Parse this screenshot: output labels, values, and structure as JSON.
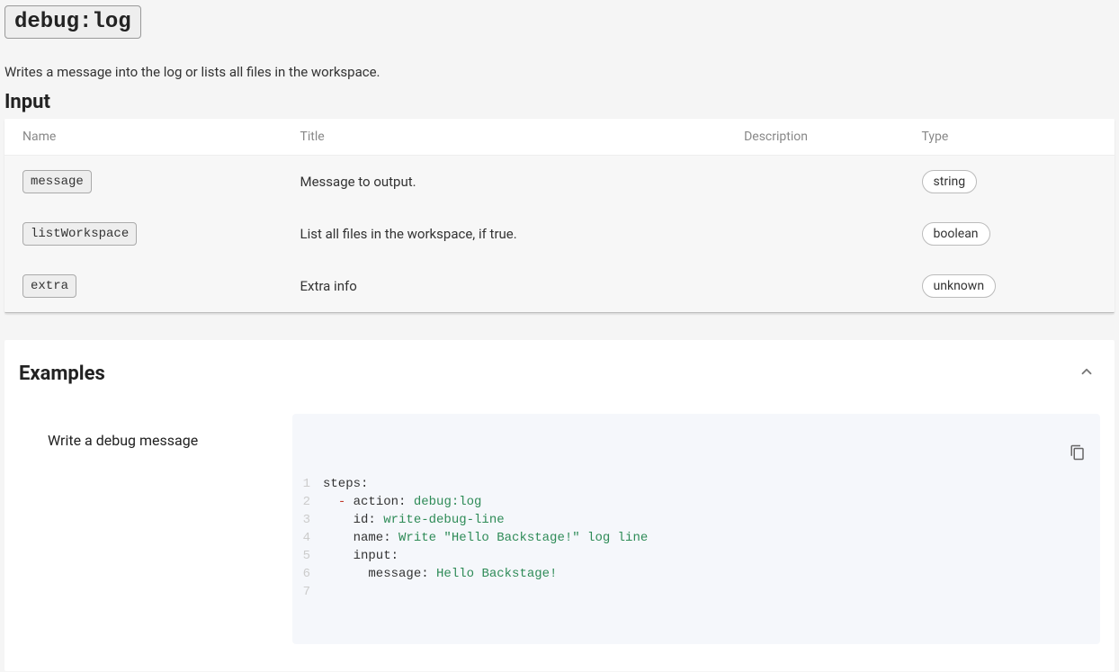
{
  "action": {
    "name": "debug:log",
    "description": "Writes a message into the log or lists all files in the workspace."
  },
  "input": {
    "heading": "Input",
    "columns": {
      "name": "Name",
      "title": "Title",
      "description": "Description",
      "type": "Type"
    },
    "rows": [
      {
        "name": "message",
        "title": "Message to output.",
        "description": "",
        "type": "string"
      },
      {
        "name": "listWorkspace",
        "title": "List all files in the workspace, if true.",
        "description": "",
        "type": "boolean"
      },
      {
        "name": "extra",
        "title": "Extra info",
        "description": "",
        "type": "unknown"
      }
    ]
  },
  "examples": {
    "heading": "Examples",
    "items": [
      {
        "label": "Write a debug message",
        "code_lines": [
          [
            {
              "t": "plain",
              "v": "steps:"
            }
          ],
          [
            {
              "t": "plain",
              "v": "  "
            },
            {
              "t": "dash",
              "v": "-"
            },
            {
              "t": "plain",
              "v": " action: "
            },
            {
              "t": "str",
              "v": "debug:log"
            }
          ],
          [
            {
              "t": "plain",
              "v": "    id: "
            },
            {
              "t": "str",
              "v": "write-debug-line"
            }
          ],
          [
            {
              "t": "plain",
              "v": "    name: "
            },
            {
              "t": "str",
              "v": "Write \"Hello Backstage!\" log line"
            }
          ],
          [
            {
              "t": "plain",
              "v": "    input:"
            }
          ],
          [
            {
              "t": "plain",
              "v": "      message: "
            },
            {
              "t": "str",
              "v": "Hello Backstage!"
            }
          ],
          []
        ]
      }
    ]
  }
}
